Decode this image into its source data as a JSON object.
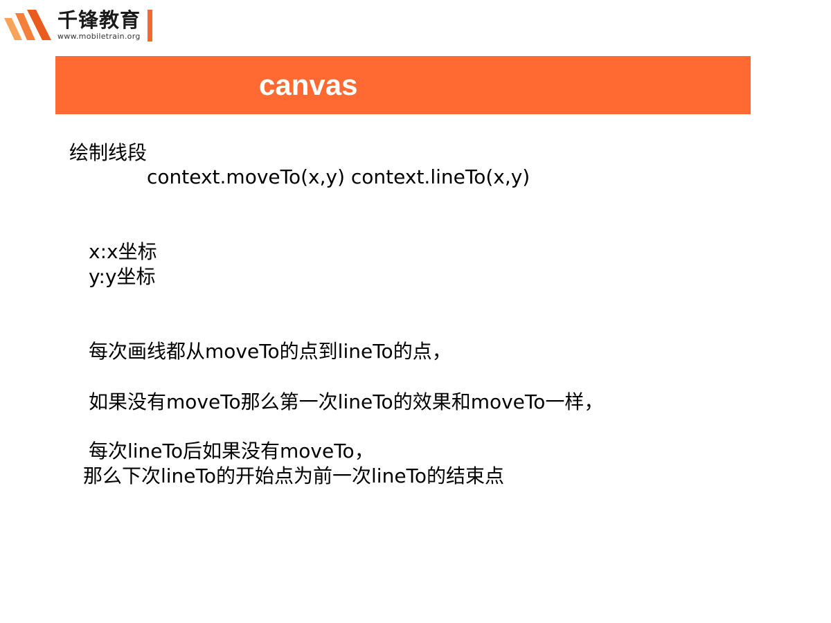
{
  "logo": {
    "brand": "千锋教育",
    "url": "www.mobiletrain.org"
  },
  "slide": {
    "title": "canvas",
    "heading": "绘制线段",
    "methods": "context.moveTo(x,y)   context.lineTo(x,y)",
    "param_x": "x:x坐标",
    "param_y": "y:y坐标",
    "note1": "每次画线都从moveTo的点到lineTo的点，",
    "note2": "如果没有moveTo那么第一次lineTo的效果和moveTo一样，",
    "note3a": "每次lineTo后如果没有moveTo，",
    "note3b": "那么下次lineTo的开始点为前一次lineTo的结束点"
  },
  "colors": {
    "accent": "#ff6a33",
    "logo_orange": "#f26b2a"
  }
}
